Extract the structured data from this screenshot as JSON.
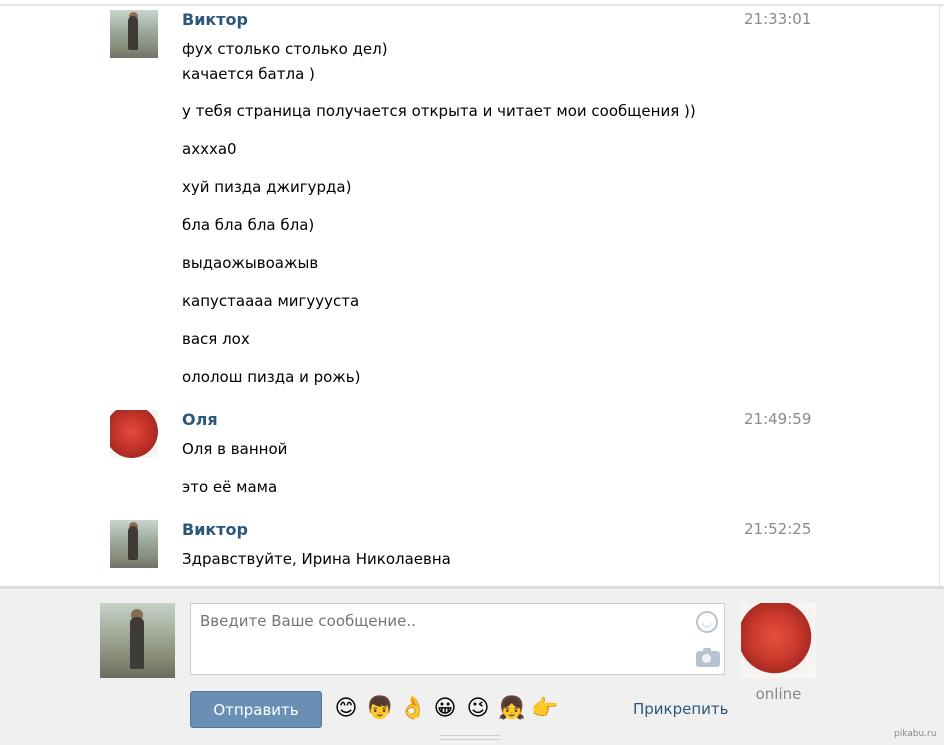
{
  "messages": [
    {
      "author": "Виктор",
      "time": "21:33:01",
      "lines": [
        "фух столько столько дел)",
        "качается батла )",
        "у тебя страница получается открыта и читает мои сообщения ))",
        "ахххa0",
        "хуй пизда джигурда)",
        "бла бла бла бла)",
        "выдаожывоажыв",
        "капустаааа мигуууста",
        "вася лох",
        "ололош пизда и рожь)"
      ]
    },
    {
      "author": "Оля",
      "time": "21:49:59",
      "lines": [
        "Оля в ванной",
        "это её мама"
      ]
    },
    {
      "author": "Виктор",
      "time": "21:52:25",
      "lines": [
        "Здравствуйте, Ирина Николаевна"
      ]
    }
  ],
  "composer": {
    "placeholder": "Введите Ваше сообщение..",
    "send_label": "Отправить",
    "attach_label": "Прикрепить",
    "peer_status": "online",
    "emojis": [
      "😊",
      "👦",
      "👌",
      "😀",
      "😉",
      "👧",
      "👉"
    ]
  },
  "watermark": "pikabu.ru"
}
